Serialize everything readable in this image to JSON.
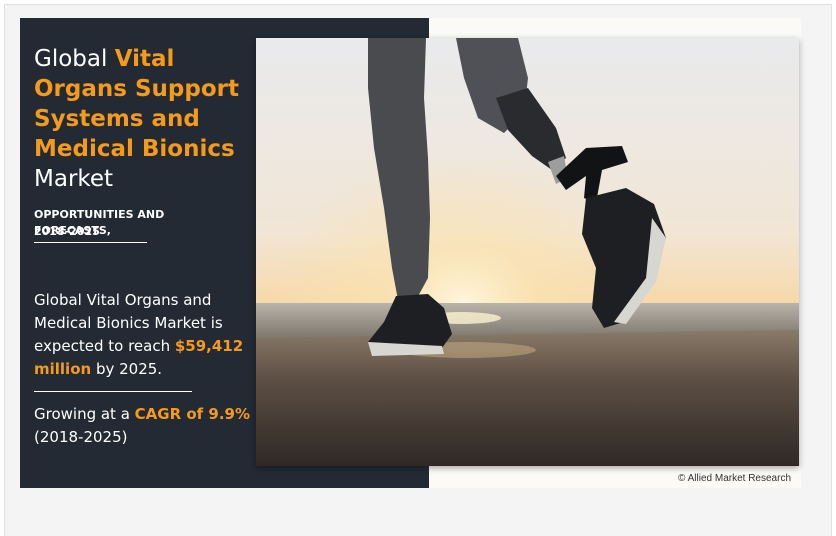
{
  "heading": {
    "prefix": "Global ",
    "highlight_1": "Vital Organs Support Systems and Medical Bionics",
    "suffix": "Market"
  },
  "subheading": {
    "line1": "OPPORTUNITIES AND FORECASTS,",
    "line2": "2018-2025"
  },
  "market_stat": {
    "text_before": "Global Vital Organs and Medical Bionics Market is expected to reach ",
    "value": "$59,412 million",
    "text_after": " by 2025."
  },
  "growth": {
    "text_before": "Growing at a ",
    "cagr": "CAGR of 9.9%",
    "period": "(2018-2025)"
  },
  "credit": "© Allied Market Research",
  "colors": {
    "panel_bg": "#232a34",
    "accent": "#f59b1c",
    "text": "#ffffff"
  },
  "image": {
    "subject": "runner with prosthetic leg at sunset on beach"
  }
}
